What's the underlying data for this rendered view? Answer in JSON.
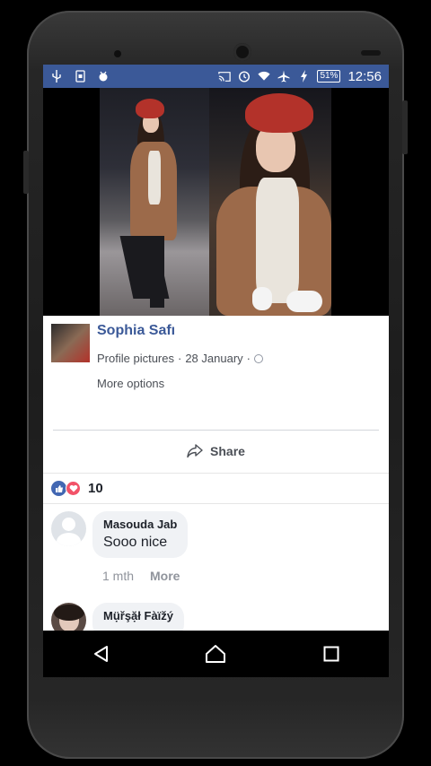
{
  "statusbar": {
    "left_icons": [
      "usb-icon",
      "sim-icon",
      "android-debug-icon"
    ],
    "right_icons": [
      "cast-icon",
      "alarm-icon",
      "wifi-icon",
      "airplane-icon",
      "charging-icon"
    ],
    "battery": "51%",
    "time": "12:56"
  },
  "post": {
    "author": "Sophia Safı",
    "album": "Profile pictures",
    "date": "28 January",
    "separator": "·",
    "more_options": "More options",
    "share_label": "Share",
    "reaction_count": "10"
  },
  "comments": [
    {
      "name": "Masouda Jab",
      "text": "Sooo nice",
      "time": "1 mth",
      "more": "More"
    },
    {
      "name": "Mụ̈řşặł Fàïžý",
      "text": ""
    }
  ],
  "colors": {
    "brand": "#3b5998",
    "bubble": "#f0f2f5"
  }
}
